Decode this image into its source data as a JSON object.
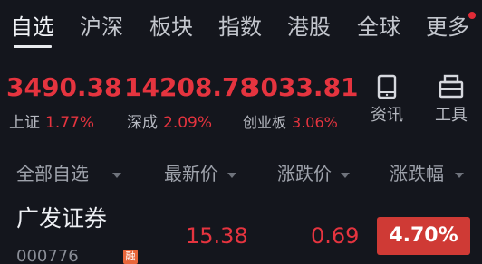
{
  "nav": {
    "tabs": [
      "自选",
      "沪深",
      "板块",
      "指数",
      "港股",
      "全球",
      "更多"
    ],
    "active_index": 0
  },
  "indices": [
    {
      "value": "3490.38",
      "name": "上证",
      "change_pct": "1.77%"
    },
    {
      "value": "14208.78",
      "name": "深成",
      "change_pct": "2.09%"
    },
    {
      "value": "3033.81",
      "name": "创业板",
      "change_pct": "3.06%"
    }
  ],
  "tools": [
    {
      "label": "资讯",
      "icon": "tablet-icon"
    },
    {
      "label": "工具",
      "icon": "printer-icon"
    }
  ],
  "columns": {
    "name": "全部自选",
    "latest": "最新价",
    "change": "涨跌价",
    "change_pct": "涨跌幅"
  },
  "rows": [
    {
      "name": "广发证券",
      "code": "000776",
      "badge": "融",
      "latest": "15.38",
      "change": "0.69",
      "change_pct": "4.70%"
    }
  ],
  "colors": {
    "background": "#14161d",
    "up": "#e5343f",
    "pct_box": "#cf3a35",
    "badge": "#e8663a",
    "notification_dot": "#e02b37"
  }
}
